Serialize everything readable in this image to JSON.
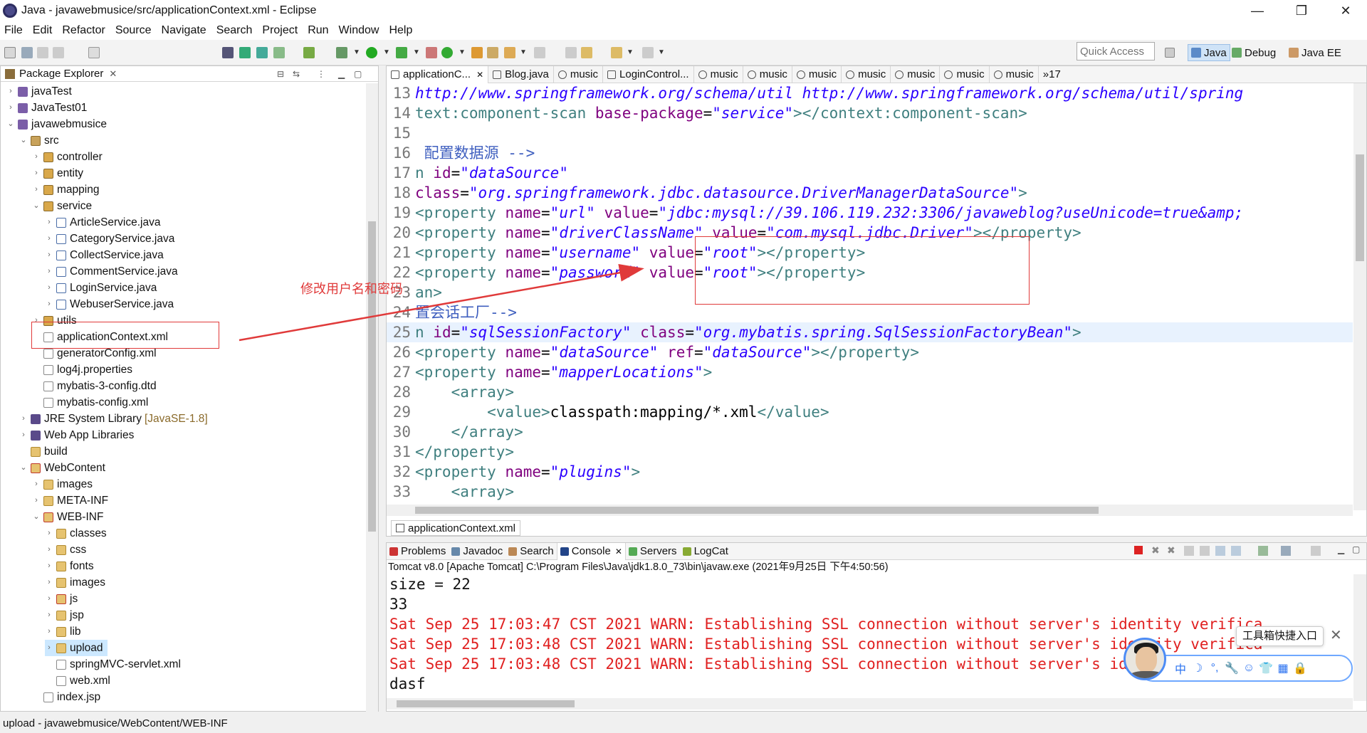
{
  "window": {
    "title": "Java - javawebmusice/src/applicationContext.xml - Eclipse",
    "controls": [
      "—",
      "❐",
      "✕"
    ]
  },
  "menu": [
    "File",
    "Edit",
    "Refactor",
    "Source",
    "Navigate",
    "Search",
    "Project",
    "Run",
    "Window",
    "Help"
  ],
  "toolbar": {
    "quick_access_placeholder": "Quick Access",
    "perspectives": [
      "Java",
      "Debug",
      "Java EE"
    ]
  },
  "package_explorer": {
    "title": "Package Explorer",
    "close": "✕",
    "items": [
      {
        "label": "javaTest",
        "aux": ""
      },
      {
        "label": "JavaTest01",
        "aux": ""
      },
      {
        "label": "javawebmusice",
        "aux": ""
      },
      {
        "label": "src",
        "aux": ""
      },
      {
        "label": "controller",
        "aux": ""
      },
      {
        "label": "entity",
        "aux": ""
      },
      {
        "label": "mapping",
        "aux": ""
      },
      {
        "label": "service",
        "aux": ""
      },
      {
        "label": "ArticleService.java",
        "aux": ""
      },
      {
        "label": "CategoryService.java",
        "aux": ""
      },
      {
        "label": "CollectService.java",
        "aux": ""
      },
      {
        "label": "CommentService.java",
        "aux": ""
      },
      {
        "label": "LoginService.java",
        "aux": ""
      },
      {
        "label": "WebuserService.java",
        "aux": ""
      },
      {
        "label": "utils",
        "aux": ""
      },
      {
        "label": "applicationContext.xml",
        "aux": ""
      },
      {
        "label": "generatorConfig.xml",
        "aux": ""
      },
      {
        "label": "log4j.properties",
        "aux": ""
      },
      {
        "label": "mybatis-3-config.dtd",
        "aux": ""
      },
      {
        "label": "mybatis-config.xml",
        "aux": ""
      },
      {
        "label": "JRE System Library",
        "aux": "[JavaSE-1.8]"
      },
      {
        "label": "Web App Libraries",
        "aux": ""
      },
      {
        "label": "build",
        "aux": ""
      },
      {
        "label": "WebContent",
        "aux": ""
      },
      {
        "label": "images",
        "aux": ""
      },
      {
        "label": "META-INF",
        "aux": ""
      },
      {
        "label": "WEB-INF",
        "aux": ""
      },
      {
        "label": "classes",
        "aux": ""
      },
      {
        "label": "css",
        "aux": ""
      },
      {
        "label": "fonts",
        "aux": ""
      },
      {
        "label": "images",
        "aux": ""
      },
      {
        "label": "js",
        "aux": ""
      },
      {
        "label": "jsp",
        "aux": ""
      },
      {
        "label": "lib",
        "aux": ""
      },
      {
        "label": "upload",
        "aux": ""
      },
      {
        "label": "springMVC-servlet.xml",
        "aux": ""
      },
      {
        "label": "web.xml",
        "aux": ""
      },
      {
        "label": "index.jsp",
        "aux": ""
      }
    ]
  },
  "editor": {
    "tabs": [
      "applicationC...",
      "Blog.java",
      "music",
      "LoginControl...",
      "music",
      "music",
      "music",
      "music",
      "music",
      "music",
      "music",
      "»17"
    ],
    "bottom_tab": "applicationContext.xml",
    "lines": [
      {
        "n": "13",
        "segs": [
          {
            "t": "http://www.springframework.org/schema/util http://www.springframework.org/schema/util/spring",
            "c": "str"
          }
        ]
      },
      {
        "n": "14",
        "segs": [
          {
            "t": "text:component-scan ",
            "c": "tag"
          },
          {
            "t": "base-package",
            "c": "attr"
          },
          {
            "t": "=",
            "c": "plain"
          },
          {
            "t": "\"service\"",
            "c": "str"
          },
          {
            "t": "></context:component-scan>",
            "c": "tag"
          }
        ]
      },
      {
        "n": "15",
        "segs": []
      },
      {
        "n": "16",
        "segs": [
          {
            "t": " 配置数据源 -->",
            "c": "cmt"
          }
        ]
      },
      {
        "n": "17",
        "segs": [
          {
            "t": "n ",
            "c": "tag"
          },
          {
            "t": "id",
            "c": "attr"
          },
          {
            "t": "=",
            "c": "plain"
          },
          {
            "t": "\"dataSource\"",
            "c": "str"
          }
        ]
      },
      {
        "n": "18",
        "segs": [
          {
            "t": "class",
            "c": "attr"
          },
          {
            "t": "=",
            "c": "plain"
          },
          {
            "t": "\"org.springframework.jdbc.datasource.DriverManagerDataSource\"",
            "c": "str"
          },
          {
            "t": ">",
            "c": "tag"
          }
        ]
      },
      {
        "n": "19",
        "segs": [
          {
            "t": "<property ",
            "c": "tag"
          },
          {
            "t": "name",
            "c": "attr"
          },
          {
            "t": "=",
            "c": "plain"
          },
          {
            "t": "\"url\"",
            "c": "str"
          },
          {
            "t": " ",
            "c": "plain"
          },
          {
            "t": "value",
            "c": "attr"
          },
          {
            "t": "=",
            "c": "plain"
          },
          {
            "t": "\"jdbc:mysql://39.106.119.232:3306/javaweblog?useUnicode=true&amp;",
            "c": "str"
          }
        ]
      },
      {
        "n": "20",
        "segs": [
          {
            "t": "<property ",
            "c": "tag"
          },
          {
            "t": "name",
            "c": "attr"
          },
          {
            "t": "=",
            "c": "plain"
          },
          {
            "t": "\"driverClassName\"",
            "c": "str"
          },
          {
            "t": " ",
            "c": "plain"
          },
          {
            "t": "value",
            "c": "attr"
          },
          {
            "t": "=",
            "c": "plain"
          },
          {
            "t": "\"com.mysql.jdbc.Driver\"",
            "c": "str"
          },
          {
            "t": "></property>",
            "c": "tag"
          }
        ]
      },
      {
        "n": "21",
        "segs": [
          {
            "t": "<property ",
            "c": "tag"
          },
          {
            "t": "name",
            "c": "attr"
          },
          {
            "t": "=",
            "c": "plain"
          },
          {
            "t": "\"username\"",
            "c": "str"
          },
          {
            "t": " ",
            "c": "plain"
          },
          {
            "t": "value",
            "c": "attr"
          },
          {
            "t": "=",
            "c": "plain"
          },
          {
            "t": "\"root\"",
            "c": "str"
          },
          {
            "t": "></property>",
            "c": "tag"
          }
        ]
      },
      {
        "n": "22",
        "segs": [
          {
            "t": "<property ",
            "c": "tag"
          },
          {
            "t": "name",
            "c": "attr"
          },
          {
            "t": "=",
            "c": "plain"
          },
          {
            "t": "\"password\"",
            "c": "str"
          },
          {
            "t": " ",
            "c": "plain"
          },
          {
            "t": "value",
            "c": "attr"
          },
          {
            "t": "=",
            "c": "plain"
          },
          {
            "t": "\"root\"",
            "c": "str"
          },
          {
            "t": "></property>",
            "c": "tag"
          }
        ]
      },
      {
        "n": "23",
        "segs": [
          {
            "t": "an>",
            "c": "tag"
          }
        ]
      },
      {
        "n": "24",
        "segs": [
          {
            "t": "置会话工厂-->",
            "c": "cmt"
          }
        ]
      },
      {
        "n": "25",
        "segs": [
          {
            "t": "n ",
            "c": "tag"
          },
          {
            "t": "id",
            "c": "attr"
          },
          {
            "t": "=",
            "c": "plain"
          },
          {
            "t": "\"sqlSessionFactory\"",
            "c": "str"
          },
          {
            "t": " ",
            "c": "plain"
          },
          {
            "t": "class",
            "c": "attr"
          },
          {
            "t": "=",
            "c": "plain"
          },
          {
            "t": "\"org.mybatis.spring.SqlSessionFactoryBean\"",
            "c": "str"
          },
          {
            "t": ">",
            "c": "tag"
          }
        ]
      },
      {
        "n": "26",
        "segs": [
          {
            "t": "<property ",
            "c": "tag"
          },
          {
            "t": "name",
            "c": "attr"
          },
          {
            "t": "=",
            "c": "plain"
          },
          {
            "t": "\"dataSource\"",
            "c": "str"
          },
          {
            "t": " ",
            "c": "plain"
          },
          {
            "t": "ref",
            "c": "attr"
          },
          {
            "t": "=",
            "c": "plain"
          },
          {
            "t": "\"dataSource\"",
            "c": "str"
          },
          {
            "t": "></property>",
            "c": "tag"
          }
        ]
      },
      {
        "n": "27",
        "segs": [
          {
            "t": "<property ",
            "c": "tag"
          },
          {
            "t": "name",
            "c": "attr"
          },
          {
            "t": "=",
            "c": "plain"
          },
          {
            "t": "\"mapperLocations\"",
            "c": "str"
          },
          {
            "t": ">",
            "c": "tag"
          }
        ]
      },
      {
        "n": "28",
        "segs": [
          {
            "t": "    <array>",
            "c": "tag"
          }
        ]
      },
      {
        "n": "29",
        "segs": [
          {
            "t": "        <value>",
            "c": "tag"
          },
          {
            "t": "classpath:mapping/*.xml",
            "c": "plain"
          },
          {
            "t": "</value>",
            "c": "tag"
          }
        ]
      },
      {
        "n": "30",
        "segs": [
          {
            "t": "    </array>",
            "c": "tag"
          }
        ]
      },
      {
        "n": "31",
        "segs": [
          {
            "t": "</property>",
            "c": "tag"
          }
        ]
      },
      {
        "n": "32",
        "segs": [
          {
            "t": "<property ",
            "c": "tag"
          },
          {
            "t": "name",
            "c": "attr"
          },
          {
            "t": "=",
            "c": "plain"
          },
          {
            "t": "\"plugins\"",
            "c": "str"
          },
          {
            "t": ">",
            "c": "tag"
          }
        ]
      },
      {
        "n": "33",
        "segs": [
          {
            "t": "    <array>",
            "c": "tag"
          }
        ]
      }
    ]
  },
  "console": {
    "tabs": [
      "Problems",
      "Javadoc",
      "Search",
      "Console",
      "Servers",
      "LogCat"
    ],
    "header": "Tomcat v8.0  [Apache Tomcat] C:\\Program Files\\Java\\jdk1.8.0_73\\bin\\javaw.exe (2021年9月25日 下午4:50:56)",
    "lines": [
      {
        "t": "size = 22",
        "warn": false
      },
      {
        "t": "33",
        "warn": false
      },
      {
        "t": "Sat Sep 25 17:03:47 CST 2021 WARN: Establishing SSL connection without server's identity verifica",
        "warn": true
      },
      {
        "t": "Sat Sep 25 17:03:48 CST 2021 WARN: Establishing SSL connection without server's identity verifica",
        "warn": true
      },
      {
        "t": "Sat Sep 25 17:03:48 CST 2021 WARN: Establishing SSL connection without server's identity verifica",
        "warn": true
      },
      {
        "t": "dasf",
        "warn": false
      }
    ]
  },
  "status_bar": "upload - javawebmusice/WebContent/WEB-INF",
  "annotation": {
    "text": "修改用户名和密码",
    "color": "#e03a3a"
  },
  "toolbox": {
    "tooltip": "工具箱快捷入口",
    "close": "✕",
    "glyphs": [
      "中",
      "☽",
      "°,",
      "🔧",
      "☺",
      "👕",
      "▦",
      "🔒"
    ]
  }
}
